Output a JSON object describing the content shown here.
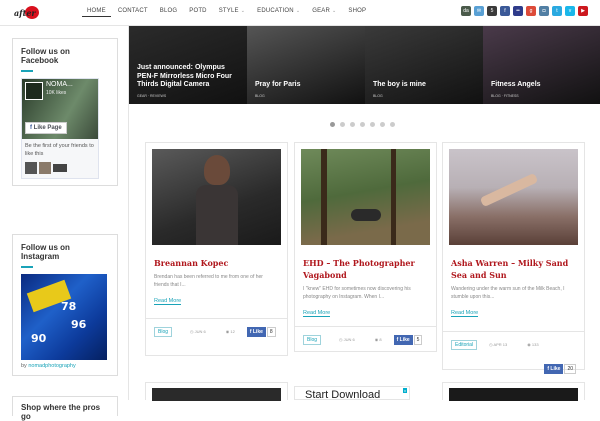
{
  "logo": {
    "text": "after",
    "accent_color": "#d9101d"
  },
  "nav": {
    "items": [
      {
        "label": "HOME",
        "active": true,
        "dropdown": false
      },
      {
        "label": "CONTACT",
        "active": false,
        "dropdown": false
      },
      {
        "label": "BLOG",
        "active": false,
        "dropdown": false
      },
      {
        "label": "POTD",
        "active": false,
        "dropdown": false
      },
      {
        "label": "STYLE",
        "active": false,
        "dropdown": true
      },
      {
        "label": "EDUCATION",
        "active": false,
        "dropdown": true
      },
      {
        "label": "GEAR",
        "active": false,
        "dropdown": true
      },
      {
        "label": "SHOP",
        "active": false,
        "dropdown": false
      }
    ],
    "caret": "⌄"
  },
  "social_icons": [
    {
      "name": "deviantart-icon",
      "glyph": "da",
      "color": "#4a5a4a"
    },
    {
      "name": "email-icon",
      "glyph": "✉",
      "color": "#59a0d4"
    },
    {
      "name": "500px-icon",
      "glyph": "5",
      "color": "#3b3b3b"
    },
    {
      "name": "facebook-icon",
      "glyph": "f",
      "color": "#3b5998"
    },
    {
      "name": "flickr-icon",
      "glyph": "••",
      "color": "#2e3b8a"
    },
    {
      "name": "googleplus-icon",
      "glyph": "g",
      "color": "#dd4b39"
    },
    {
      "name": "instagram-icon",
      "glyph": "◘",
      "color": "#517fa4"
    },
    {
      "name": "twitter-icon",
      "glyph": "t",
      "color": "#2aa9e0"
    },
    {
      "name": "vimeo-icon",
      "glyph": "v",
      "color": "#1ab7ea"
    },
    {
      "name": "youtube-icon",
      "glyph": "▶",
      "color": "#cc181e"
    }
  ],
  "sidebar": {
    "facebook": {
      "title": "Follow us on Facebook",
      "page_name": "NOMA...",
      "likes": "10K likes",
      "like_button": "Like Page",
      "text": "Be the first of your friends to like this"
    },
    "instagram": {
      "title": "Follow us on Instagram",
      "caption_prefix": "by",
      "caption_user": "nomadphotography",
      "overlay": [
        "78",
        "96",
        "90"
      ]
    },
    "bottom_widget_title": "Shop where the pros go"
  },
  "slider": {
    "slides": [
      {
        "caption": "Just announced: Olympus PEN-F Mirrorless Micro Four Thirds Digital Camera",
        "meta": "GEAR · REVIEWS",
        "bg": "#2b2b2b"
      },
      {
        "caption": "Pray for Paris",
        "meta": "BLOG",
        "bg": "#555"
      },
      {
        "caption": "The boy is mine",
        "meta": "BLOG",
        "bg": "#3a3a3a"
      },
      {
        "caption": "Fitness Angels",
        "meta": "BLOG · FITNESS",
        "bg": "#4a3a4a"
      }
    ],
    "dot_count": 7,
    "active_dot": 0
  },
  "posts": [
    {
      "title": "Breannan Kopec",
      "excerpt": "Brendan has been referred to me from one of her friends that I...",
      "read_more": "Read More",
      "tag": "Blog",
      "date": "JUN 6",
      "views": "12",
      "like_label": "Like",
      "like_count": "8"
    },
    {
      "title": "EHD – The Photographer Vagabond",
      "excerpt": "I \"knew\" EHD for sometimes now discovering his photography on Instagram. When I...",
      "read_more": "Read More",
      "tag": "Blog",
      "date": "JUN 6",
      "views": "8",
      "like_label": "Like",
      "like_count": "5"
    },
    {
      "title": "Asha Warren – Milky Sand Sea and Sun",
      "excerpt": "Wandering under the warm sun of the Milk Beach, I stumble upon this...",
      "read_more": "Read More",
      "tag": "Editorial",
      "date": "APR 13",
      "views": "133",
      "like_label": "Like",
      "like_count": "20"
    }
  ],
  "ad": {
    "text": "Start Download",
    "badge": "x"
  }
}
